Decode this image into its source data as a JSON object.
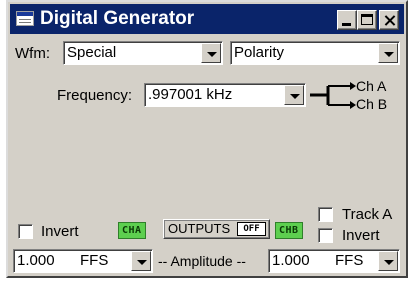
{
  "window": {
    "title": "Digital Generator"
  },
  "waveform": {
    "label": "Wfm:",
    "type": "Special",
    "mode": "Polarity"
  },
  "frequency": {
    "label": "Frequency:",
    "value": ".997001 kHz"
  },
  "routing": {
    "ch_a": "Ch A",
    "ch_b": "Ch B"
  },
  "channel_a": {
    "invert_label": "Invert",
    "badge": "CHA",
    "invert_checked": false
  },
  "outputs": {
    "label": "OUTPUTS",
    "state": "OFF"
  },
  "channel_b": {
    "badge": "CHB",
    "track_label": "Track A",
    "invert_label": "Invert",
    "track_checked": false,
    "invert_checked": false
  },
  "amplitude": {
    "label": "-- Amplitude --",
    "ch_a_value": "1.000",
    "ch_a_unit": "FFS",
    "ch_b_value": "1.000",
    "ch_b_unit": "FFS"
  },
  "colors": {
    "titlebar": "#0a246a",
    "window_face": "#d4d0c8",
    "channel_badge": "#5dcf4f"
  },
  "icons": {
    "app": "generator-window-icon",
    "route": "split-arrow-icon"
  }
}
